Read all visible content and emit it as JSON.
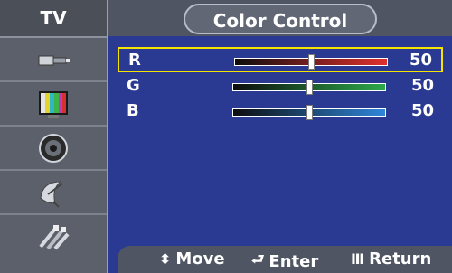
{
  "sidebar": {
    "title": "TV",
    "icons": [
      "input-plug-icon",
      "color-bars-icon",
      "speaker-icon",
      "satellite-dish-icon",
      "cables-icon"
    ]
  },
  "header": {
    "title": "Color Control"
  },
  "rows": [
    {
      "label": "R",
      "value": "50",
      "level_percent": 50,
      "color": "#e0302d",
      "selected": true
    },
    {
      "label": "G",
      "value": "50",
      "level_percent": 50,
      "color": "#2ca84a",
      "selected": false
    },
    {
      "label": "B",
      "value": "50",
      "level_percent": 50,
      "color": "#2e86d9",
      "selected": false
    }
  ],
  "footer": {
    "move_label": "Move",
    "enter_label": "Enter",
    "return_label": "Return"
  },
  "colors": {
    "background": "#2a3a93",
    "highlight": "#f5e400"
  }
}
